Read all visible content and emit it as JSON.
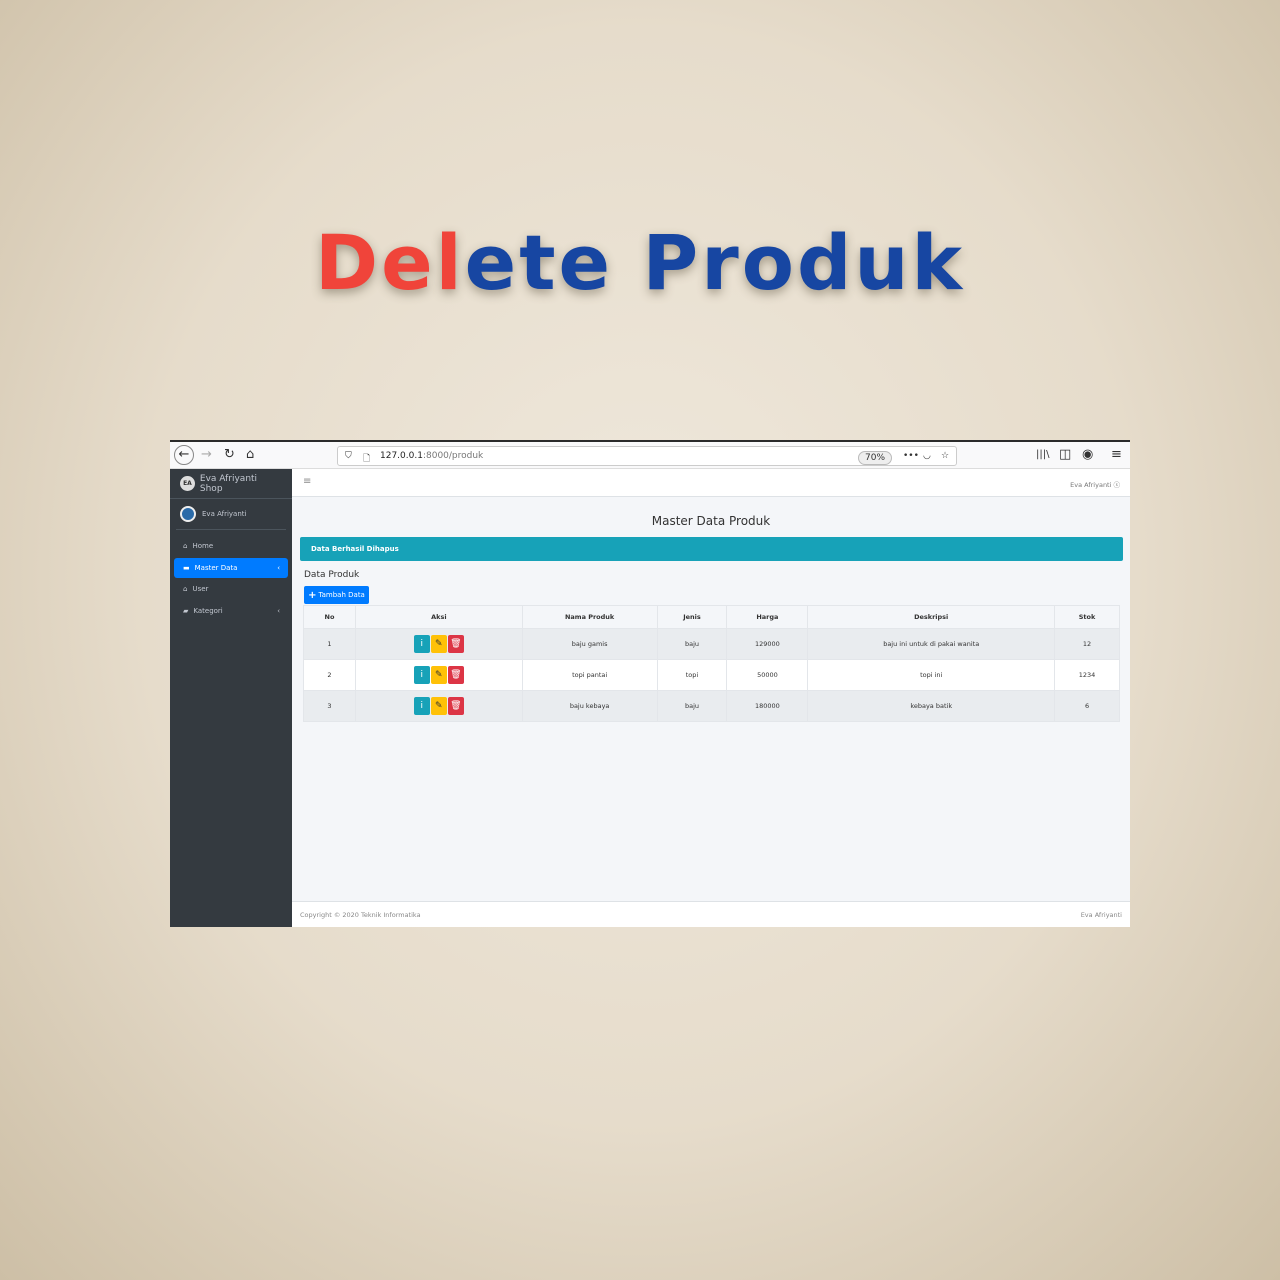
{
  "heading": {
    "part1": "Del",
    "part2": "ete Produk",
    "color1": "#f0443a",
    "color2": "#1746a2"
  },
  "browser": {
    "url_host": "127.0.0.1",
    "url_path": ":8000/produk",
    "zoom": "70%"
  },
  "sidebar": {
    "brand": "Eva Afriyanti Shop",
    "logo": "EA",
    "user": "Eva Afriyanti",
    "items": [
      {
        "label": "Home",
        "icon": "home-icon"
      },
      {
        "label": "Master Data",
        "icon": "car-icon",
        "active": true
      },
      {
        "label": "User",
        "icon": "home-icon"
      },
      {
        "label": "Kategori",
        "icon": "folder-icon"
      }
    ]
  },
  "header": {
    "user": "Eva Afriyanti"
  },
  "page": {
    "title": "Master Data Produk",
    "alert": "Data Berhasil Dihapus",
    "subtitle": "Data Produk",
    "add_button": "Tambah Data"
  },
  "table": {
    "headers": [
      "No",
      "Aksi",
      "Nama Produk",
      "Jenis",
      "Harga",
      "Deskripsi",
      "Stok"
    ],
    "rows": [
      [
        "1",
        "baju gamis",
        "baju",
        "129000",
        "baju ini untuk di pakai wanita",
        "12"
      ],
      [
        "2",
        "topi pantai",
        "topi",
        "50000",
        "topi ini",
        "1234"
      ],
      [
        "3",
        "baju kebaya",
        "baju",
        "180000",
        "kebaya batik",
        "6"
      ]
    ]
  },
  "colors": {
    "info": "#17a2b8",
    "warning": "#ffc107",
    "danger": "#dc3545",
    "primary": "#007bff"
  },
  "footer": {
    "left": "Copyright © 2020 Teknik Informatika",
    "right": "Eva Afriyanti"
  }
}
